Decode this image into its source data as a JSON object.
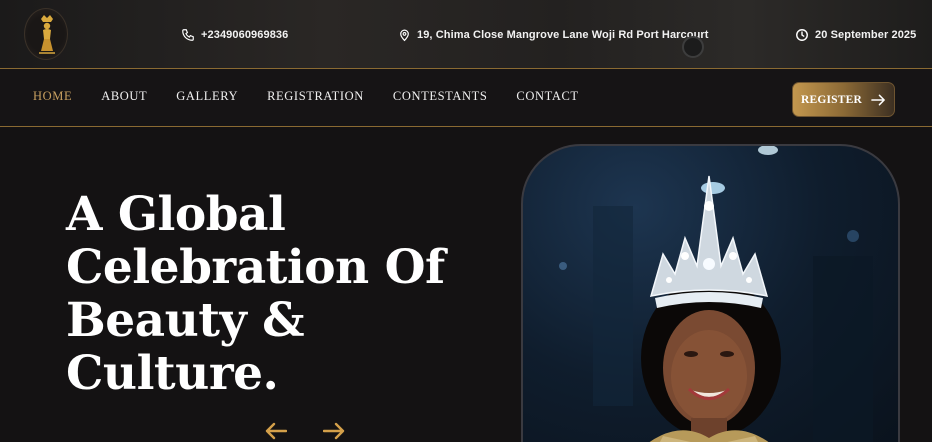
{
  "topbar": {
    "phone": "+2349060969836",
    "address": "19, Chima Close Mangrove Lane Woji Rd Port Harcourt",
    "date": "20 September 2025"
  },
  "nav": {
    "items": [
      {
        "label": "HOME",
        "active": true
      },
      {
        "label": "ABOUT",
        "active": false
      },
      {
        "label": "GALLERY",
        "active": false
      },
      {
        "label": "REGISTRATION",
        "active": false
      },
      {
        "label": "CONTESTANTS",
        "active": false
      },
      {
        "label": "CONTACT",
        "active": false
      }
    ],
    "register_label": "REGISTER"
  },
  "hero": {
    "title_lines": [
      "A Global",
      "Celebration Of",
      "Beauty &",
      "Culture."
    ]
  },
  "colors": {
    "accent": "#c8a060",
    "background": "#141213",
    "divider": "#8a6a32"
  },
  "icons": {
    "phone": "phone-icon",
    "address": "map-pin-icon",
    "date": "clock-icon",
    "register": "arrow-right-icon",
    "slider_prev": "arrow-left-icon",
    "slider_next": "arrow-right-icon"
  }
}
